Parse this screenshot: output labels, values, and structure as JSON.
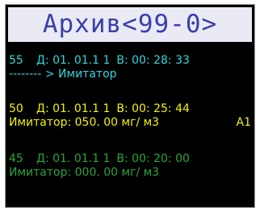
{
  "title": "Архив<99-0>",
  "records": [
    {
      "number": "55",
      "date": "Д: 01. 01.1 1",
      "time": "В: 00: 28: 33",
      "line2": "-------- > Имитатор",
      "line2_right": ""
    },
    {
      "number": "50",
      "date": "Д: 01. 01.1 1",
      "time": "В: 00: 25: 44",
      "line2": "Имитатор: 050. 00 мг/ м3",
      "line2_right": "А1"
    },
    {
      "number": "45",
      "date": "Д: 01. 01.1 1",
      "time": "В: 00: 20: 00",
      "line2": "Имитатор: 000. 00 мг/ м3",
      "line2_right": ""
    }
  ],
  "colors": {
    "record_1": "#33d6dd",
    "record_2": "#f2f20a",
    "record_3": "#2aa63a",
    "title_text": "#3a3fa8",
    "title_background": "#e9eaf4",
    "screen_background": "#000000"
  }
}
